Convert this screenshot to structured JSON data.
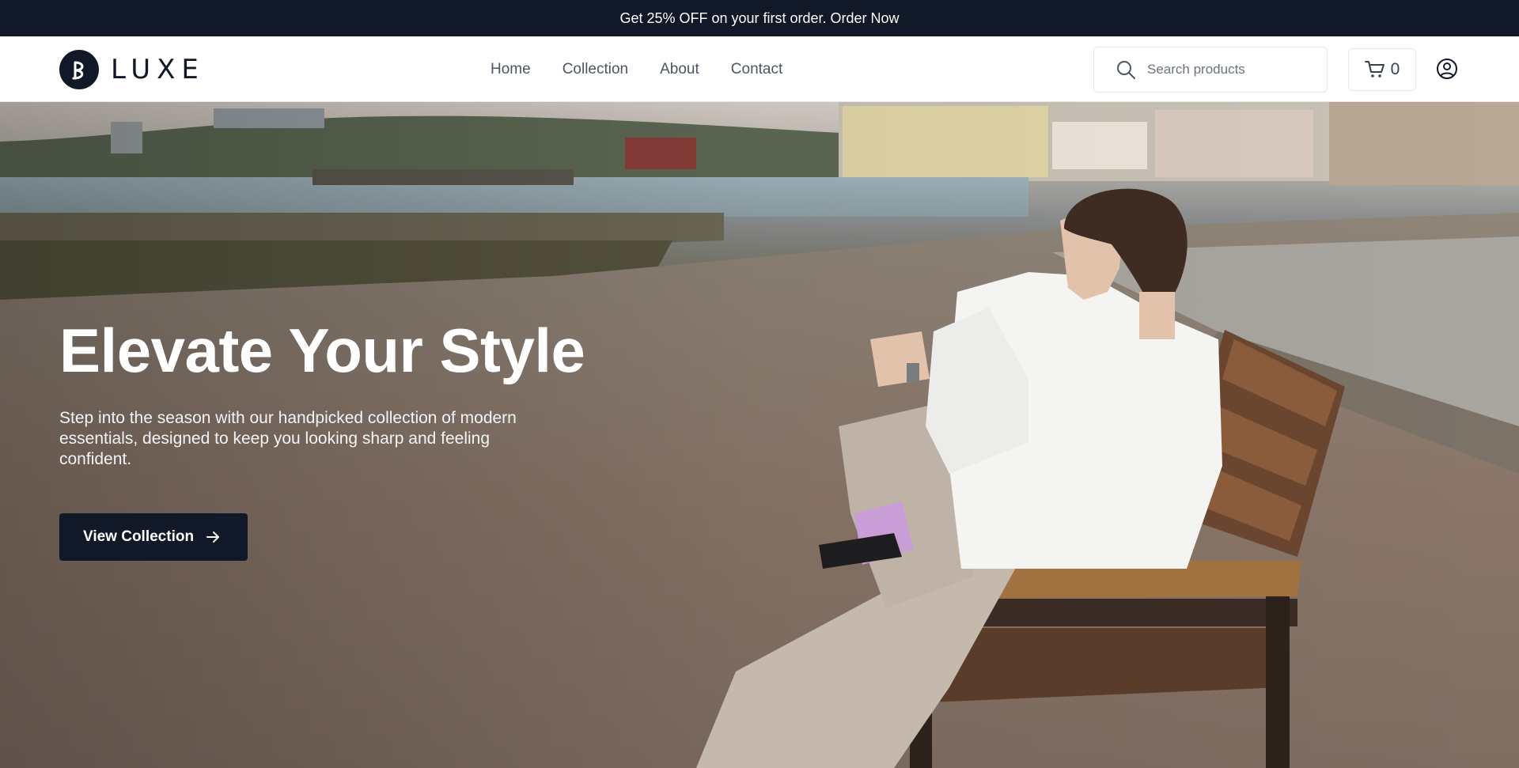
{
  "announcement": {
    "text": "Get 25% OFF on your first order. Order Now"
  },
  "brand": {
    "name": "LUXE",
    "logo_icon": "logo-mark-icon"
  },
  "nav": {
    "items": [
      {
        "label": "Home"
      },
      {
        "label": "Collection"
      },
      {
        "label": "About"
      },
      {
        "label": "Contact"
      }
    ]
  },
  "search": {
    "placeholder": "Search products",
    "value": "",
    "icon": "search-icon"
  },
  "cart": {
    "count": "0",
    "icon": "cart-icon"
  },
  "account": {
    "icon": "user-circle-icon"
  },
  "hero": {
    "title": "Elevate Your Style",
    "subtitle": "Step into the season with our handpicked collection of modern essentials, designed to keep you looking sharp and feeling confident.",
    "cta_label": "View Collection",
    "cta_icon": "arrow-right-icon"
  },
  "colors": {
    "primary": "#111827",
    "text_muted": "#4b5563",
    "border": "#e5e7eb"
  }
}
